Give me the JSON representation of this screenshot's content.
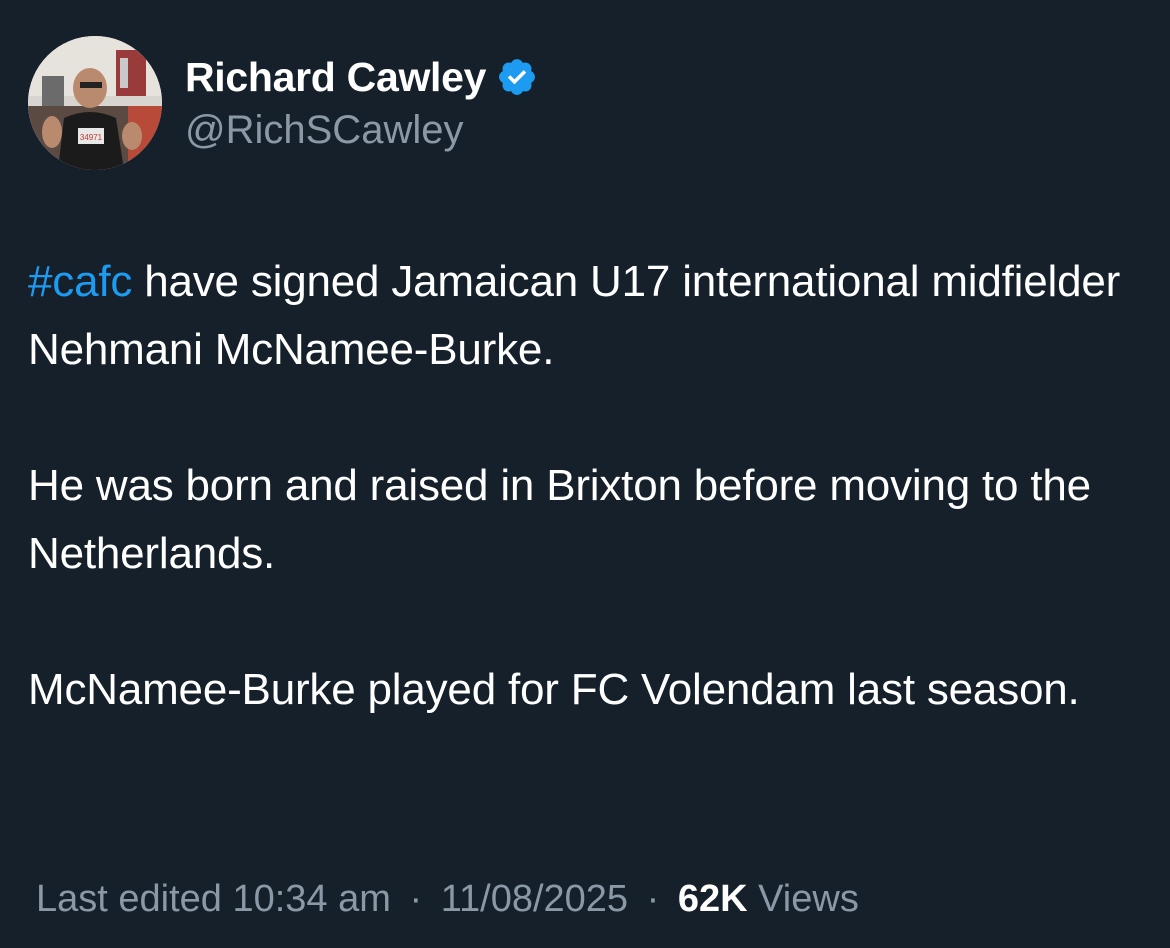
{
  "author": {
    "display_name": "Richard Cawley",
    "handle": "@RichSCawley",
    "verified": true,
    "avatar_icon": "profile-photo"
  },
  "tweet": {
    "hashtag": "#cafc",
    "paragraph_1_rest": " have signed Jamaican U17 international midfielder Nehmani McNamee-Burke.",
    "paragraph_2": "He was born and raised in Brixton before moving to the Netherlands.",
    "paragraph_3": "McNamee-Burke played for FC Volendam last season."
  },
  "meta": {
    "edited_label": "Last edited 10:34 am",
    "separator": "·",
    "date": "11/08/2025",
    "views_count": "62K",
    "views_label": "Views"
  },
  "colors": {
    "background": "#15202b",
    "link": "#1d9bf0",
    "secondary_text": "#8b98a5",
    "verified_badge": "#1d9bf0"
  }
}
